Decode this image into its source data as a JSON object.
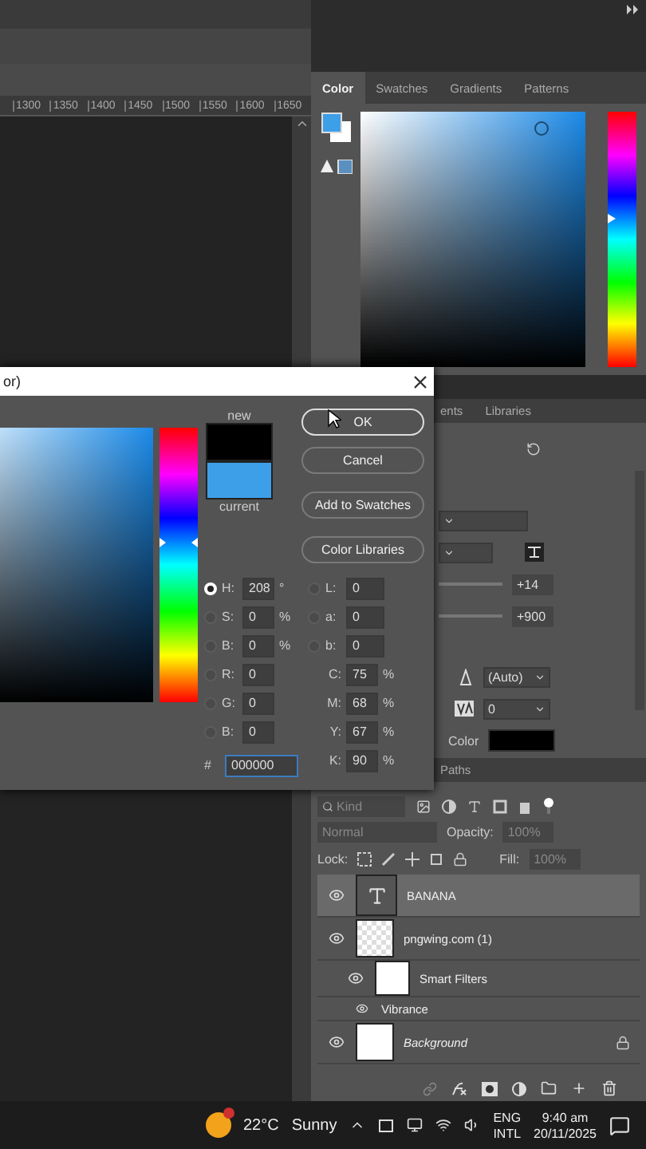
{
  "canvas": {
    "ruler_ticks": [
      "1300",
      "1350",
      "1400",
      "1450",
      "1500",
      "1550",
      "1600",
      "1650"
    ]
  },
  "color_panel": {
    "hue": {
      "level": 0.58
    },
    "tabs": [
      {
        "label": "Color",
        "selected": true
      },
      {
        "label": "Swatches",
        "selected": false
      },
      {
        "label": "Gradients",
        "selected": false
      },
      {
        "label": "Patterns",
        "selected": false
      }
    ]
  },
  "character_panel": {
    "tabs": [
      {
        "label": "ents",
        "selected": false
      },
      {
        "label": "Libraries",
        "selected": false
      }
    ],
    "fields": [
      "+14",
      "+900"
    ],
    "leading": "(Auto)",
    "kerning": "0",
    "color_label": "Color"
  },
  "layers_panel": {
    "tabs": [
      {
        "label": "Paths",
        "selected": false
      }
    ],
    "filter_placeholder": "Kind",
    "blend_mode": "Normal",
    "opacity_label": "Opacity:",
    "opacity": "100%",
    "lock_label": "Lock:",
    "fill_label": "Fill:",
    "fill": "100%",
    "layers": [
      {
        "kind": "text",
        "name": "BANANA",
        "selected": true,
        "visible": true,
        "locked": false
      },
      {
        "kind": "smart",
        "name": "pngwing.com (1)",
        "selected": false,
        "visible": true,
        "locked": false,
        "children": [
          {
            "kind": "filters",
            "name": "Smart Filters",
            "visible": true,
            "children": [
              {
                "kind": "filter",
                "name": "Vibrance",
                "visible": true
              }
            ]
          }
        ]
      },
      {
        "kind": "background",
        "name": "Background",
        "selected": false,
        "visible": true,
        "locked": true
      }
    ]
  },
  "dialog": {
    "title": "or)",
    "hue": {
      "level": 0.58
    },
    "swatches": [
      {
        "label": "new",
        "color": "#000000"
      },
      {
        "label": "current",
        "color": "#3d9fe8"
      }
    ],
    "buttons": [
      {
        "label": "OK",
        "default": true
      },
      {
        "label": "Cancel",
        "default": false
      },
      {
        "label": "Add to Swatches",
        "default": false
      },
      {
        "label": "Color Libraries",
        "default": false
      }
    ],
    "left_fields": [
      {
        "label": "H:",
        "value": "208",
        "unit": "°",
        "selected": true
      },
      {
        "label": "S:",
        "value": "0",
        "unit": "%",
        "selected": false
      },
      {
        "label": "B:",
        "value": "0",
        "unit": "%",
        "selected": false
      },
      {
        "label": "R:",
        "value": "0",
        "selected": false
      },
      {
        "label": "G:",
        "value": "0",
        "selected": false
      },
      {
        "label": "B:",
        "value": "0",
        "selected": false
      }
    ],
    "right_fields": [
      {
        "kind": "radio",
        "label": "L:",
        "value": "0",
        "selected": false
      },
      {
        "kind": "radio",
        "label": "a:",
        "value": "0",
        "selected": false
      },
      {
        "kind": "radio",
        "label": "b:",
        "value": "0",
        "selected": false
      },
      {
        "kind": "plain",
        "label": "C:",
        "value": "75",
        "unit": "%"
      },
      {
        "kind": "plain",
        "label": "M:",
        "value": "68",
        "unit": "%"
      },
      {
        "kind": "plain",
        "label": "Y:",
        "value": "67",
        "unit": "%"
      },
      {
        "kind": "plain",
        "label": "K:",
        "value": "90",
        "unit": "%"
      }
    ],
    "hex": {
      "label": "#",
      "value": "000000"
    }
  },
  "taskbar": {
    "temperature": "22°C",
    "weather": "Sunny",
    "language": "ENG",
    "layout": "INTL",
    "time": "9:40 am",
    "date": "20/11/2025"
  }
}
